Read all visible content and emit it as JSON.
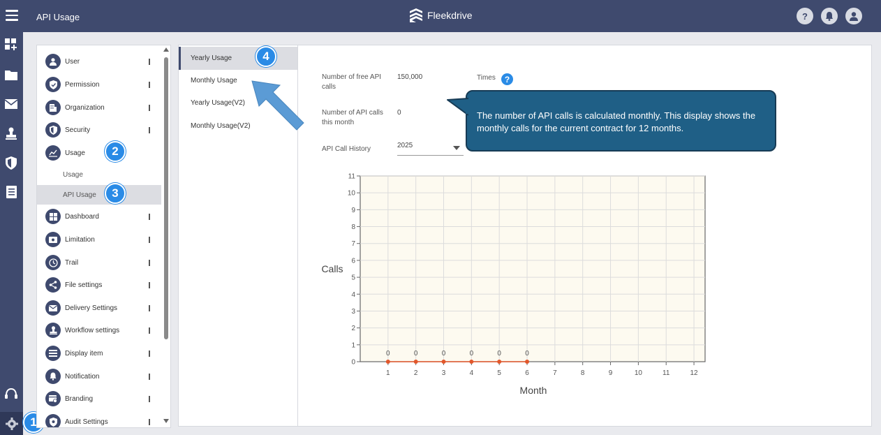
{
  "header": {
    "title": "API Usage",
    "brand": "Fleekdrive",
    "help_label": "?"
  },
  "rail": {
    "icons": [
      "apps-icon",
      "folder-icon",
      "mail-icon",
      "stamp-icon",
      "shield-icon",
      "book-icon",
      "support-icon",
      "gear-icon"
    ]
  },
  "markers": [
    "1",
    "2",
    "3",
    "4"
  ],
  "menu": {
    "items": [
      {
        "label": "User",
        "icon": "user-icon"
      },
      {
        "label": "Permission",
        "icon": "shield-check-icon"
      },
      {
        "label": "Organization",
        "icon": "building-icon"
      },
      {
        "label": "Security",
        "icon": "security-icon"
      },
      {
        "label": "Usage",
        "icon": "chart-icon"
      },
      {
        "label": "Dashboard",
        "icon": "dashboard-icon"
      },
      {
        "label": "Limitation",
        "icon": "limitation-icon"
      },
      {
        "label": "Trail",
        "icon": "clock-icon"
      },
      {
        "label": "File settings",
        "icon": "share-icon"
      },
      {
        "label": "Delivery Settings",
        "icon": "mail-icon"
      },
      {
        "label": "Workflow settings",
        "icon": "stamp-icon"
      },
      {
        "label": "Display item",
        "icon": "list-icon"
      },
      {
        "label": "Notification",
        "icon": "bell-icon"
      },
      {
        "label": "Branding",
        "icon": "branding-icon"
      },
      {
        "label": "Audit Settings",
        "icon": "audit-icon"
      }
    ],
    "sub_items": [
      {
        "label": "Usage"
      },
      {
        "label": "API Usage"
      }
    ]
  },
  "tabs": [
    {
      "label": "Yearly Usage"
    },
    {
      "label": "Monthly Usage"
    },
    {
      "label": "Yearly Usage(V2)"
    },
    {
      "label": "Monthly Usage(V2)"
    }
  ],
  "fields": {
    "free_calls_label": "Number of free API calls",
    "free_calls_value": "150,000",
    "times_label": "Times",
    "month_calls_label": "Number of API calls this month",
    "month_calls_value": "0",
    "history_label": "API Call History",
    "history_value": "2025"
  },
  "callout": {
    "text": "The number of API calls is calculated monthly. This display shows the monthly calls for the current contract for 12 months."
  },
  "colors": {
    "nav": "#3f4a6e",
    "accent": "#2a8be6",
    "callout": "#1f5f86",
    "chart_bg": "#fdfaf0",
    "point": "#e2572b"
  },
  "chart_data": {
    "type": "line",
    "x": [
      1,
      2,
      3,
      4,
      5,
      6,
      7,
      8,
      9,
      10,
      11,
      12
    ],
    "series": [
      {
        "values": [
          0,
          0,
          0,
          0,
          0,
          0
        ]
      }
    ],
    "data_labels": [
      "0",
      "0",
      "0",
      "0",
      "0",
      "0"
    ],
    "xlabel": "Month",
    "ylabel": "Calls",
    "ylim": [
      0,
      11
    ],
    "yticks": [
      0,
      1,
      2,
      3,
      4,
      5,
      6,
      7,
      8,
      9,
      10,
      11
    ],
    "grid": true
  }
}
